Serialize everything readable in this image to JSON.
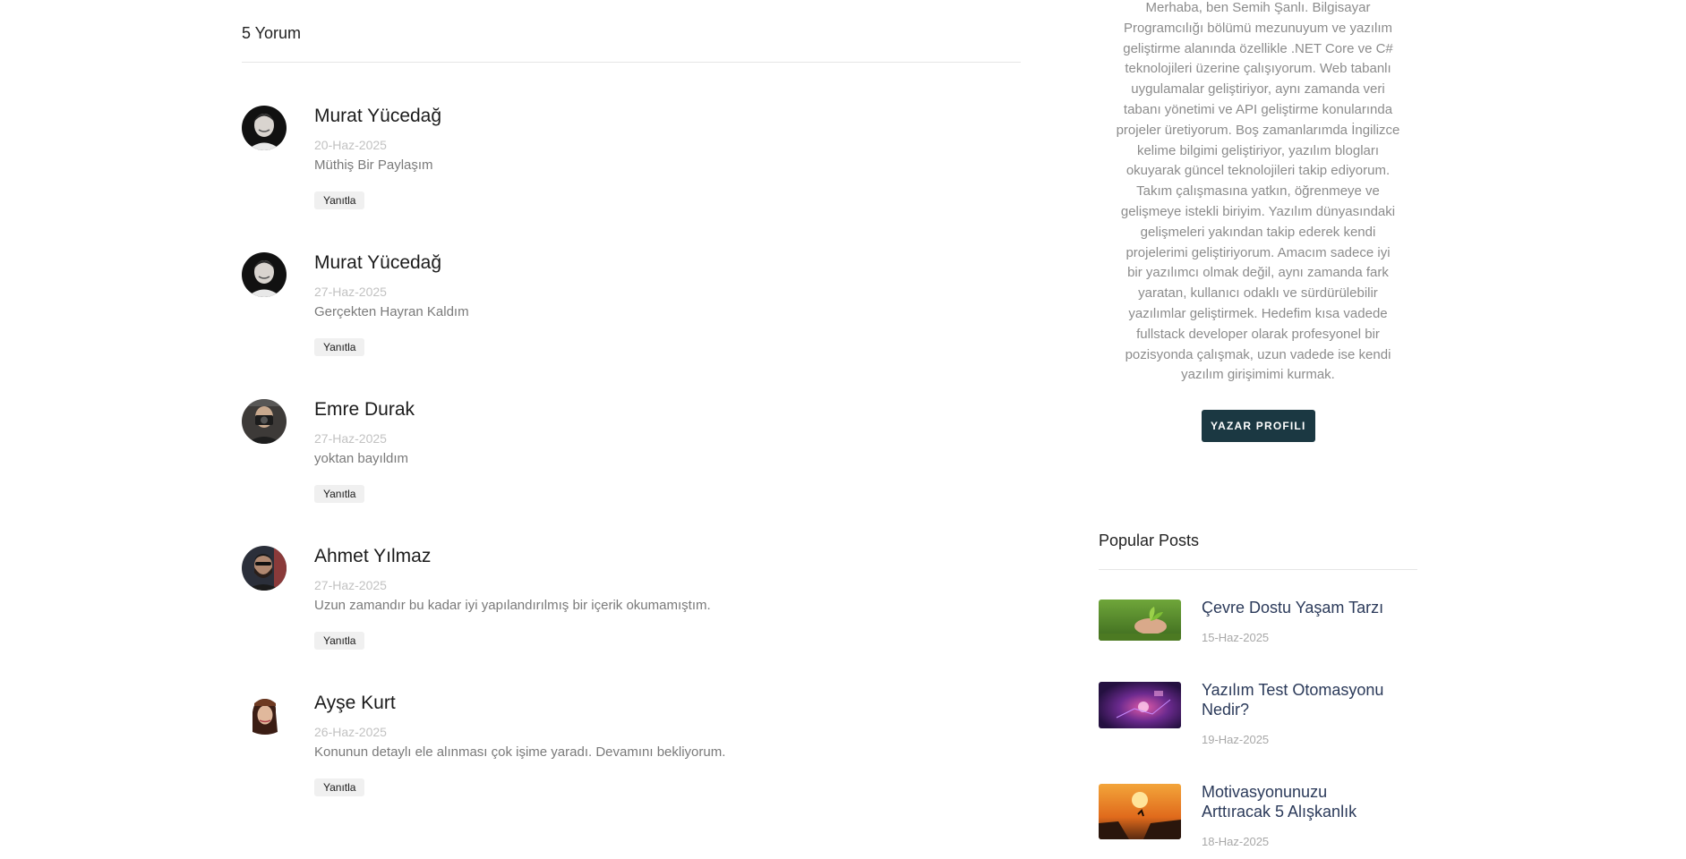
{
  "comments": {
    "heading": "5 Yorum",
    "items": [
      {
        "name": "Murat Yücedağ",
        "date": "20-Haz-2025",
        "text": "Müthiş Bir Paylaşım",
        "reply_label": "Yanıtla"
      },
      {
        "name": "Murat Yücedağ",
        "date": "27-Haz-2025",
        "text": "Gerçekten Hayran Kaldım",
        "reply_label": "Yanıtla"
      },
      {
        "name": "Emre Durak",
        "date": "27-Haz-2025",
        "text": "yoktan bayıldım",
        "reply_label": "Yanıtla"
      },
      {
        "name": "Ahmet Yılmaz",
        "date": "27-Haz-2025",
        "text": "Uzun zamandır bu kadar iyi yapılandırılmış bir içerik okumamıştım.",
        "reply_label": "Yanıtla"
      },
      {
        "name": "Ayşe Kurt",
        "date": "26-Haz-2025",
        "text": "Konunun detaylı ele alınması çok işime yaradı. Devamını bekliyorum.",
        "reply_label": "Yanıtla"
      }
    ]
  },
  "author": {
    "bio_lines": [
      "Merhaba, ben Semih Şanlı. Bilgisayar",
      "Programcılığı bölümü mezunuyum ve yazılım",
      "geliştirme alanında özellikle .NET Core ve C#",
      "teknolojileri üzerine çalışıyorum. Web tabanlı",
      "uygulamalar geliştiriyor, aynı zamanda veri",
      "tabanı yönetimi ve API geliştirme konularında",
      "projeler üretiyorum. Boş zamanlarımda İngilizce",
      "kelime bilgimi geliştiriyor, yazılım blogları",
      "okuyarak güncel teknolojileri takip ediyorum.",
      "Takım çalışmasına yatkın, öğrenmeye ve",
      "gelişmeye istekli biriyim. Yazılım dünyasındaki",
      "gelişmeleri yakından takip ederek kendi",
      "projelerimi geliştiriyorum. Amacım sadece iyi",
      "bir yazılımcı olmak değil, aynı zamanda fark",
      "yaratan, kullanıcı odaklı ve sürdürülebilir",
      "yazılımlar geliştirmek. Hedefim kısa vadede",
      "fullstack developer olarak profesyonel bir",
      "pozisyonda çalışmak, uzun vadede ise kendi",
      "yazılım girişimimi kurmak."
    ],
    "profile_button": "YAZAR PROFILI"
  },
  "popular": {
    "heading": "Popular Posts",
    "posts": [
      {
        "title_lines": [
          "Çevre Dostu Yaşam Tarzı"
        ],
        "date": "15-Haz-2025"
      },
      {
        "title_lines": [
          "Yazılım Test Otomasyonu",
          "Nedir?"
        ],
        "date": "19-Haz-2025"
      },
      {
        "title_lines": [
          "Motivasyonunuzu",
          "Arttıracak 5 Alışkanlık"
        ],
        "date": "18-Haz-2025"
      }
    ]
  },
  "colors": {
    "accent_button": "#1b3842",
    "post_title": "#2b3a5a",
    "muted_text": "#8c8c8c"
  }
}
